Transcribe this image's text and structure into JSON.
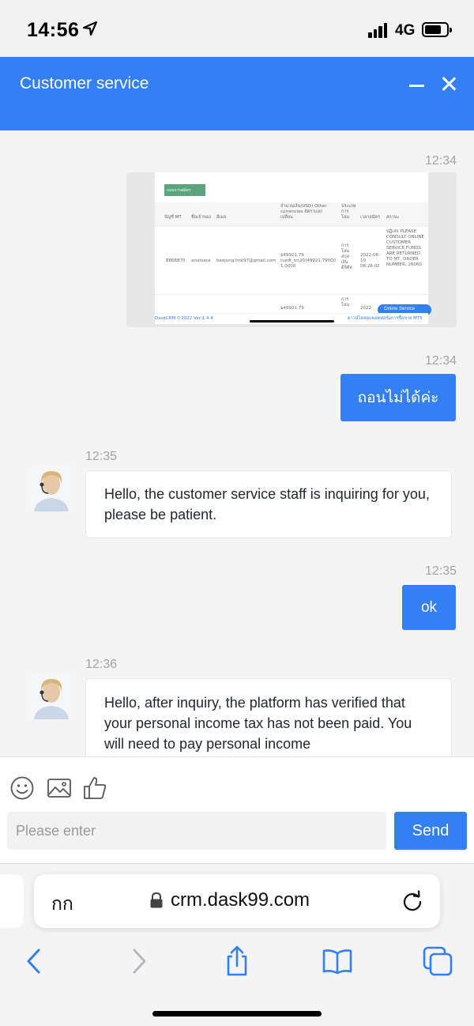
{
  "status_bar": {
    "time": "14:56",
    "network": "4G"
  },
  "header": {
    "title": "Customer service"
  },
  "chat": {
    "messages": [
      {
        "side": "user",
        "time": "12:34",
        "type": "image"
      },
      {
        "side": "user",
        "time": "12:34",
        "text": "ถอนไม่ได้ค่ะ"
      },
      {
        "side": "agent",
        "time": "12:35",
        "text": "Hello, the customer service staff is inquiring for you, please be patient."
      },
      {
        "side": "user",
        "time": "12:35",
        "text": "ok"
      },
      {
        "side": "agent",
        "time": "12:36",
        "text": "Hello, after inquiry, the platform has verified that your personal income tax has not been paid. You will need to pay personal income"
      }
    ],
    "screenshot": {
      "button": "ถอนการสมัคร",
      "col_account": "บัญชี MT",
      "col_name": "ชื่อเจ้าของ",
      "col_email": "อีเมล",
      "col_amount": "จำนวนเงิน(USD) Other currencies อัตราแลกเปลี่ยน",
      "col_type": "ประเภท การ โอน",
      "col_time": "เวลาสมัคร",
      "col_status": "สถานะ",
      "row_account": "8866870",
      "row_name": "anutsara",
      "row_email": "beejung.hnk97@gmail.com",
      "row_amount": "$49921.79 (usdt_trc20)49921.79000 1.0000",
      "row_type": "การ โอน สกุล เงิน ดิจิทัล",
      "row_time": "2022-06-10 08:26:02",
      "row_status": "ปฏิเสธ PLEASE CONSULT ONLINE CUSTOMER SERVICE,FUNDS ARE RETURNED TO MT, ORDER NUMBER: 26060",
      "row2_amount": "$49921.79",
      "row2_type": "การ โอน",
      "row2_time": "2022",
      "online_service": "Online Service",
      "footer_left": "DaskCRM ©2022 Ver:1.4.4",
      "footer_right": "ดาวน์โหลดแพลตฟอร์มการซื้อขาย MT5"
    }
  },
  "composer": {
    "placeholder": "Please enter",
    "send_label": "Send"
  },
  "browser": {
    "aa_label": "กก",
    "url": "crm.dask99.com"
  },
  "colors": {
    "accent": "#337ff3",
    "chat_bg": "#f4f4f5"
  }
}
